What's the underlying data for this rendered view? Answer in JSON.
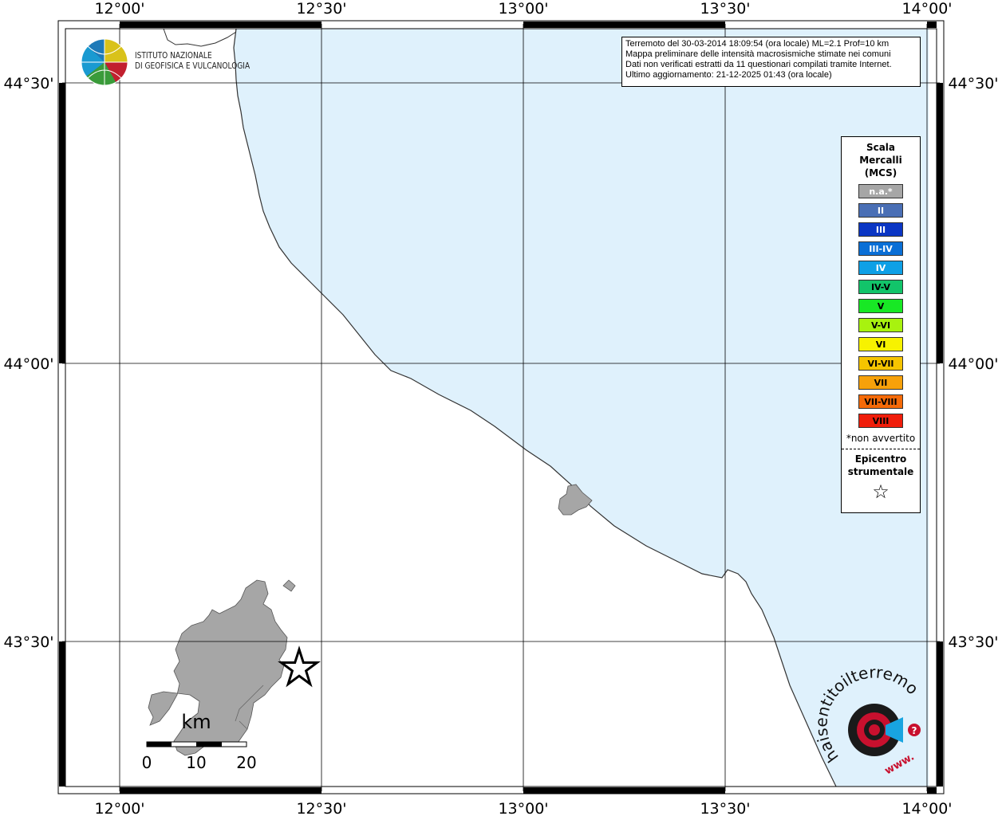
{
  "axis": {
    "lon_labels": [
      "12°00'",
      "12°30'",
      "13°00'",
      "13°30'",
      "14°00'"
    ],
    "lat_labels": [
      "44°30'",
      "44°00'",
      "43°30'"
    ]
  },
  "logo": {
    "line1": "ISTITUTO NAZIONALE",
    "line2": "DI GEOFISICA E VULCANOLOGIA"
  },
  "info": {
    "line1": "Terremoto del 30-03-2014 18:09:54 (ora locale) ML=2.1 Prof=10 km",
    "line2": "Mappa preliminare delle intensità macrosismiche stimate nei comuni",
    "line3": "Dati non verificati estratti da 11 questionari compilati tramite Internet.",
    "line4": "Ultimo aggiornamento: 21-12-2025 01:43 (ora locale)"
  },
  "legend": {
    "title_line1": "Scala",
    "title_line2": "Mercalli",
    "title_line3": "(MCS)",
    "levels": [
      {
        "label": "n.a.*",
        "color": "#a6a6a6",
        "text_color": "#ffffff"
      },
      {
        "label": "II",
        "color": "#4a6fb5",
        "text_color": "#ffffff"
      },
      {
        "label": "III",
        "color": "#0b36c4",
        "text_color": "#ffffff"
      },
      {
        "label": "III-IV",
        "color": "#0a6fd6",
        "text_color": "#ffffff"
      },
      {
        "label": "IV",
        "color": "#0ea0e6",
        "text_color": "#ffffff"
      },
      {
        "label": "IV-V",
        "color": "#12c46a",
        "text_color": "#000000"
      },
      {
        "label": "V",
        "color": "#18e825",
        "text_color": "#000000"
      },
      {
        "label": "V-VI",
        "color": "#a8f20f",
        "text_color": "#000000"
      },
      {
        "label": "VI",
        "color": "#f7f200",
        "text_color": "#000000"
      },
      {
        "label": "VI-VII",
        "color": "#f5c400",
        "text_color": "#000000"
      },
      {
        "label": "VII",
        "color": "#f7a10a",
        "text_color": "#000000"
      },
      {
        "label": "VII-VIII",
        "color": "#f56a08",
        "text_color": "#000000"
      },
      {
        "label": "VIII",
        "color": "#f01d0a",
        "text_color": "#000000"
      }
    ],
    "note": "*non avvertito",
    "epicenter_line1": "Epicentro",
    "epicenter_line2": "strumentale",
    "epicenter_symbol": "☆"
  },
  "scalebar": {
    "unit": "km",
    "ticks": [
      "0",
      "10",
      "20"
    ]
  },
  "badge": {
    "text_main": "haisentitoilterremoto.it",
    "text_sub": "www.",
    "text_q": "?"
  },
  "colors": {
    "sea": "#dff1fc",
    "land_territory": "#a6a6a6",
    "frame": "#000000"
  }
}
